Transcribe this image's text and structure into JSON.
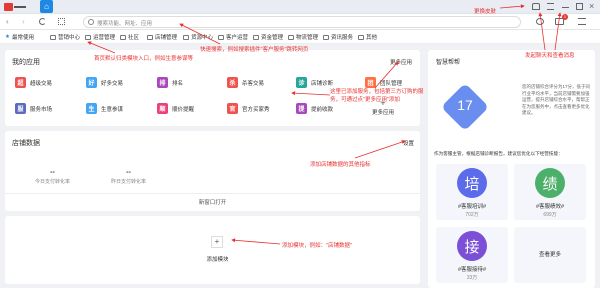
{
  "browser": {
    "home_label": "⌂",
    "search_placeholder": "搜索功能、网址、应用",
    "bookmarks": [
      "最常使用",
      "营销中心",
      "运营管理",
      "社区",
      "店铺管理",
      "货源中心",
      "客户运营",
      "资金管理",
      "物流管理",
      "资讯服务",
      "其他"
    ]
  },
  "my_apps": {
    "title": "我的应用",
    "more": "更多应用",
    "items": [
      {
        "label": "超级交易",
        "color": "#ef5350",
        "glyph": "超"
      },
      {
        "label": "好多交易",
        "color": "#42a5f5",
        "glyph": "好"
      },
      {
        "label": "排名",
        "color": "#ab47bc",
        "glyph": "排"
      },
      {
        "label": "杀客交易",
        "color": "#ef5350",
        "glyph": "杀"
      },
      {
        "label": "店铺诊断",
        "color": "#26a69a",
        "glyph": "诊"
      },
      {
        "label": "团队管理",
        "color": "#ff7043",
        "glyph": "团"
      },
      {
        "label": "服务市场",
        "color": "#5c6bc0",
        "glyph": "服"
      },
      {
        "label": "生意参谋",
        "color": "#42a5f5",
        "glyph": "生"
      },
      {
        "label": "顺价提醒",
        "color": "#ec407a",
        "glyph": "顺"
      },
      {
        "label": "官方买家秀",
        "color": "#ef5350",
        "glyph": "官"
      },
      {
        "label": "提前收款",
        "color": "#ab47bc",
        "glyph": "提"
      }
    ],
    "add_label": "+",
    "add_more": "更多应用"
  },
  "shop_data": {
    "title": "店铺数据",
    "settings": "设置",
    "stats": [
      {
        "value": "--",
        "label": "今日支付转化率"
      },
      {
        "value": "--",
        "label": "昨日支付转化率"
      }
    ],
    "footer": "新窗口打开"
  },
  "add_module": {
    "plus": "+",
    "label": "添加模块"
  },
  "smart_help": {
    "title": "智慧帮帮",
    "score": "17",
    "desc": "您的店铺综合评分为17分，低于同行业平均水平，当前店铺需要加强运营，提升店铺综合水平，帮帮正在为您服务中，点击查看更多优化建议。",
    "prompt": "作为客服主管，根据店铺诊断报告，建议您优化以下经营技能：",
    "cards": [
      {
        "glyph": "培",
        "color": "#5b6bea",
        "name": "#客服培训#",
        "sub": "702万"
      },
      {
        "glyph": "绩",
        "color": "#4caf6a",
        "name": "#客服绩效#",
        "sub": "699万"
      },
      {
        "glyph": "接",
        "color": "#7b4fd6",
        "name": "#客服接待#",
        "sub": "33万"
      }
    ],
    "view_more": "查看更多"
  },
  "annotations": {
    "skin": "更换皮肤",
    "quick_search": "快速搜索，例如搜索插件\"客户服务\"跳转网页",
    "default_entry": "首页默认归类模块入口，例如生意参谋等",
    "notify": "发起聊天和查看消息",
    "app_desc": "这里已添加服务，包括第三方订购的服务，可通过点\"更多应用\"添加",
    "shop_add": "添加店铺数据的其他指标",
    "module_add": "添加模块，例如：\"店铺数据\""
  }
}
